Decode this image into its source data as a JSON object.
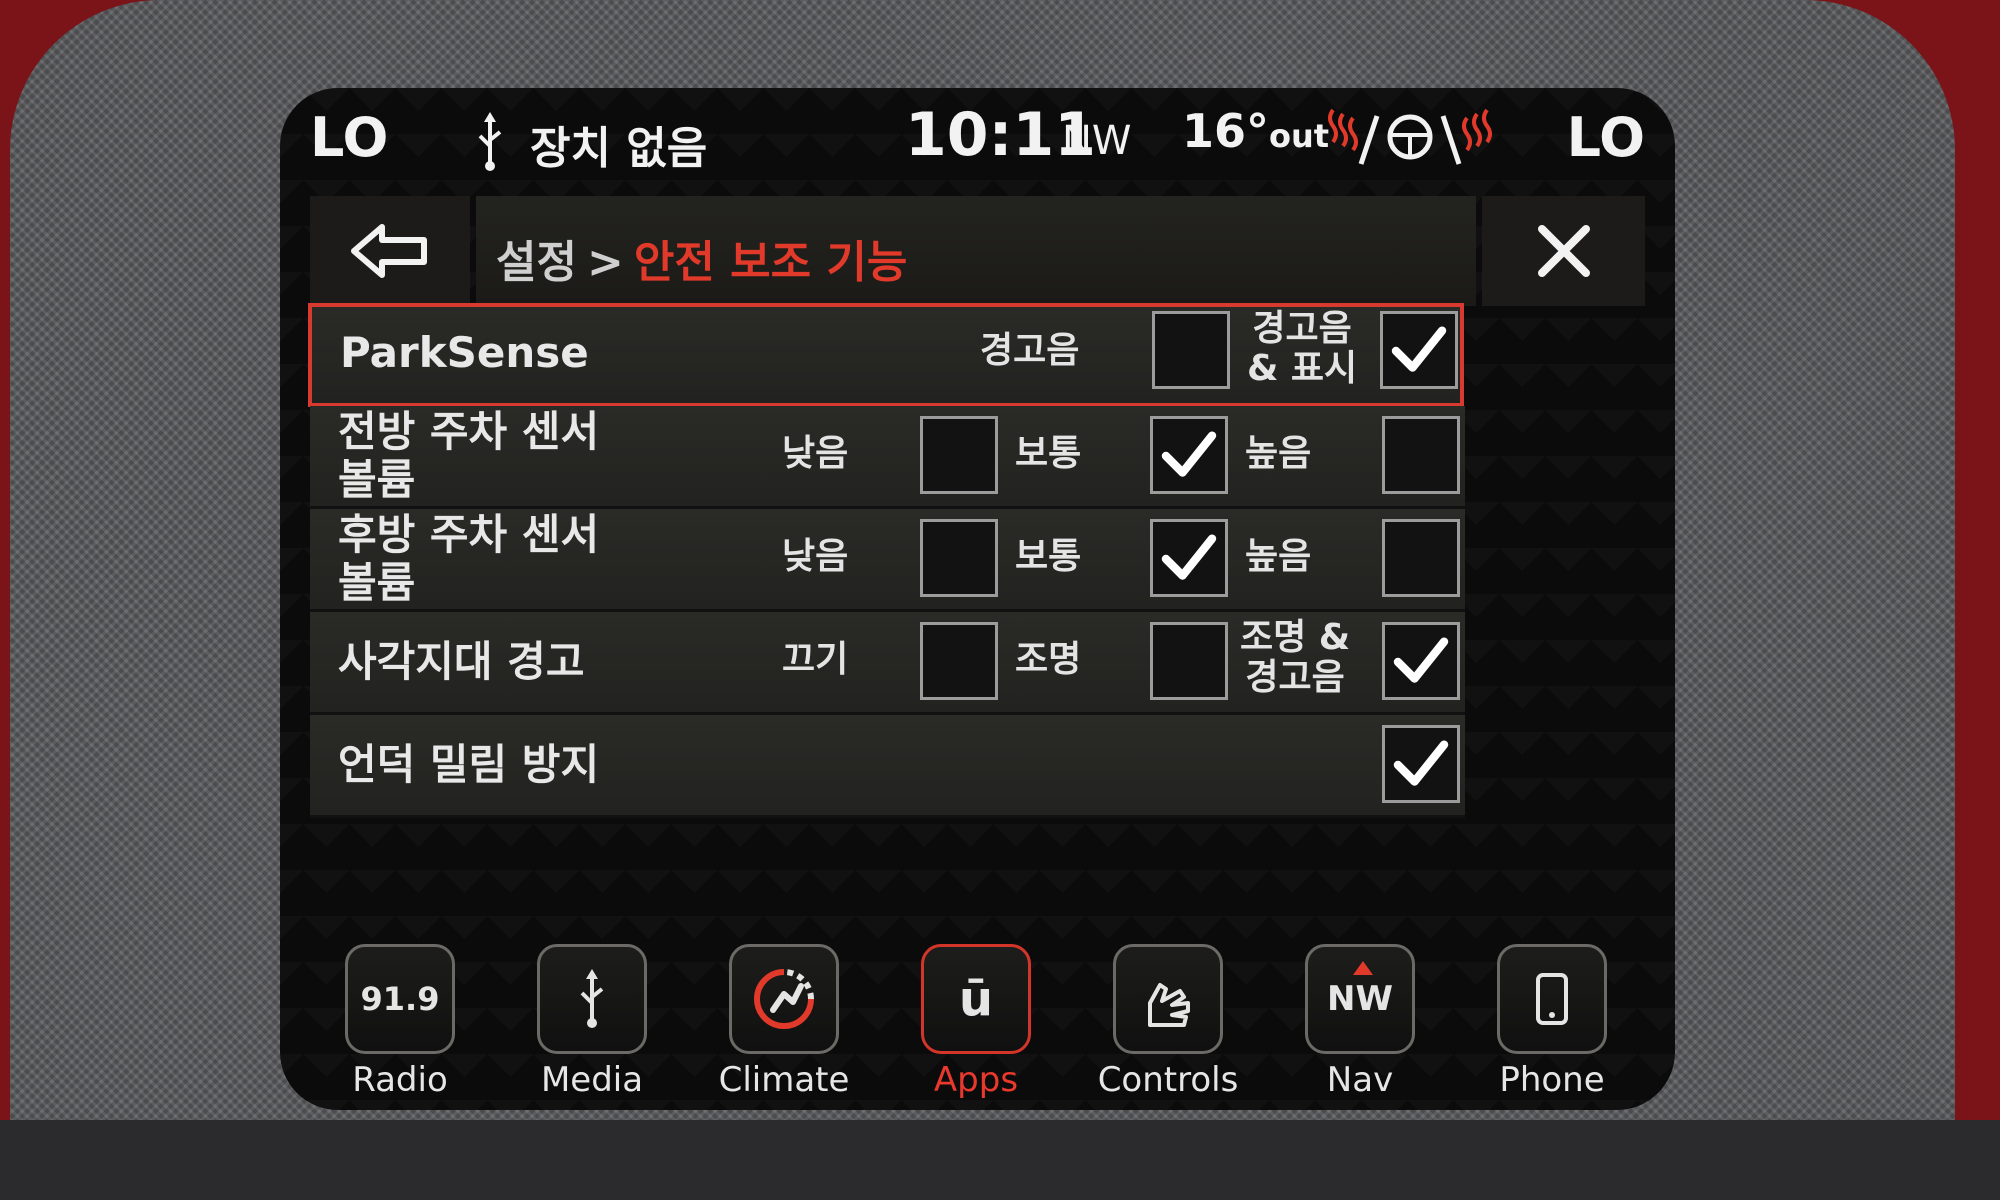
{
  "status_bar": {
    "left_temp": "LO",
    "right_temp": "LO",
    "device_status": "장치 없음",
    "time": "10:11",
    "compass": "NW",
    "outside_temp": "16°",
    "outside_temp_unit": "out",
    "icons": [
      "usb-icon",
      "heated-seat-left-icon",
      "heated-steering-wheel-icon",
      "heated-seat-right-icon"
    ]
  },
  "header": {
    "breadcrumb_parent": "설정",
    "breadcrumb_separator": ">",
    "breadcrumb_current": "안전 보조 기능",
    "back_icon": "back-arrow-icon",
    "close_icon": "close-icon"
  },
  "settings": {
    "parksense": {
      "label": "ParkSense",
      "options": [
        {
          "label": "경고음",
          "checked": false
        },
        {
          "label_line1": "경고음",
          "label_line2": "& 표시",
          "checked": true
        }
      ]
    },
    "front_volume": {
      "label_line1": "전방 주차 센서",
      "label_line2": "볼륨",
      "options": [
        {
          "label": "낮음",
          "checked": false
        },
        {
          "label": "보통",
          "checked": true
        },
        {
          "label": "높음",
          "checked": false
        }
      ]
    },
    "rear_volume": {
      "label_line1": "후방 주차 센서",
      "label_line2": "볼륨",
      "options": [
        {
          "label": "낮음",
          "checked": false
        },
        {
          "label": "보통",
          "checked": true
        },
        {
          "label": "높음",
          "checked": false
        }
      ]
    },
    "blind_spot": {
      "label": "사각지대 경고",
      "options": [
        {
          "label": "끄기",
          "checked": false
        },
        {
          "label": "조명",
          "checked": false
        },
        {
          "label_line1": "조명 &",
          "label_line2": "경고음",
          "checked": true
        }
      ]
    },
    "hill_start": {
      "label": "언덕 밀림 방지",
      "checked": true
    }
  },
  "nav": {
    "active": "Apps",
    "items": [
      {
        "label": "Radio",
        "icon_text": "91.9"
      },
      {
        "label": "Media",
        "icon": "usb-icon"
      },
      {
        "label": "Climate",
        "icon": "climate-fan-icon"
      },
      {
        "label": "Apps",
        "icon": "apps-icon",
        "icon_text": "ū"
      },
      {
        "label": "Controls",
        "icon": "controls-hand-icon"
      },
      {
        "label": "Nav",
        "icon_text": "NW"
      },
      {
        "label": "Phone",
        "icon": "phone-icon"
      }
    ]
  },
  "colors": {
    "accent": "#e23a2a",
    "background": "#0b0b0c",
    "bezel": "#5d5e61",
    "text": "#e8e8e8"
  }
}
